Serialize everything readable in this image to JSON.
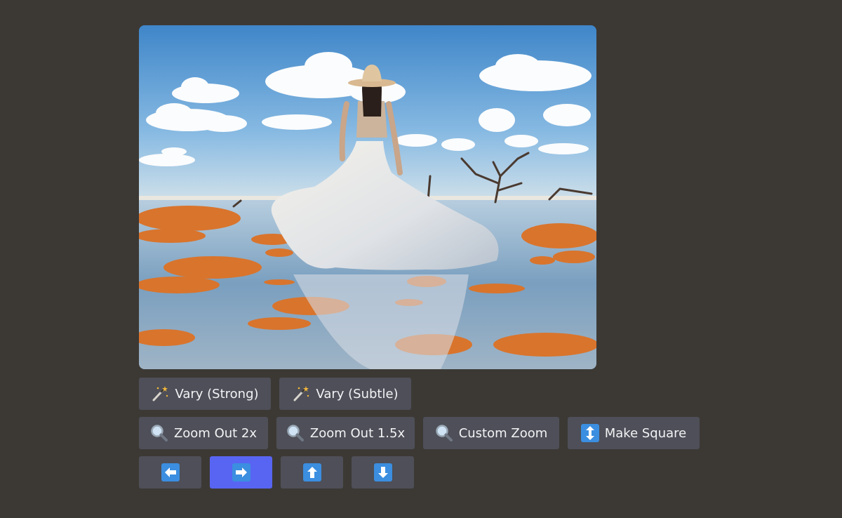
{
  "result": {
    "image_alt": "Woman in white flowing gown and straw hat standing in shallow water among orange rock patches and bare trees under a blue cloudy sky"
  },
  "variation_buttons": [
    {
      "label": "Vary (Strong)",
      "icon": "magic-wand-icon"
    },
    {
      "label": "Vary (Subtle)",
      "icon": "magic-wand-icon"
    }
  ],
  "zoom_buttons": [
    {
      "label": "Zoom Out 2x",
      "icon": "magnifier-icon"
    },
    {
      "label": "Zoom Out 1.5x",
      "icon": "magnifier-icon"
    },
    {
      "label": "Custom Zoom",
      "icon": "magnifier-icon"
    },
    {
      "label": "Make Square",
      "icon": "up-down-arrow-icon"
    }
  ],
  "pan_buttons": [
    {
      "icon": "arrow-left-icon",
      "active": false
    },
    {
      "icon": "arrow-right-icon",
      "active": true
    },
    {
      "icon": "arrow-up-icon",
      "active": false
    },
    {
      "icon": "arrow-down-icon",
      "active": false
    }
  ],
  "colors": {
    "background": "#3c3935",
    "button": "#4e4f58",
    "button_active": "#5865f2",
    "arrow_icon": "#3b8ee0"
  }
}
